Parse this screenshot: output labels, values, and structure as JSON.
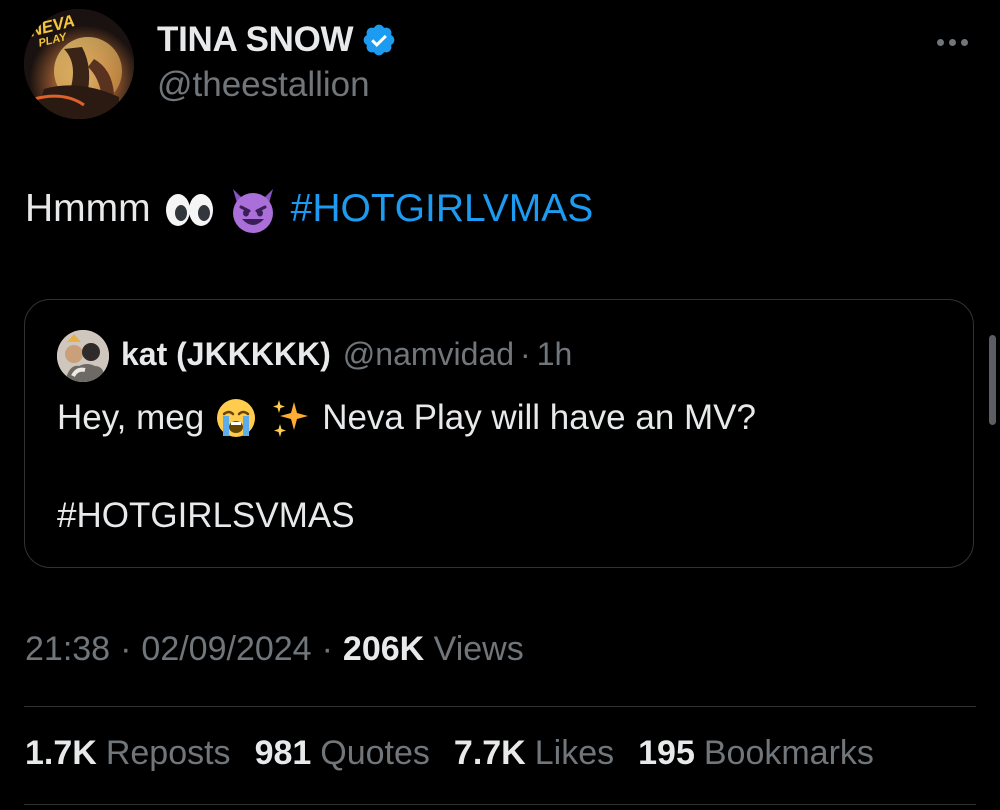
{
  "author": {
    "display_name": "TINA SNOW",
    "handle": "@theestallion",
    "verified": true,
    "avatar_logo_text_1": "NEVA",
    "avatar_logo_text_2": "PLAY"
  },
  "tweet": {
    "text": "Hmmm",
    "emojis": [
      "eyes-emoji",
      "smiling-devil-emoji"
    ],
    "hashtag": "#HOTGIRLVMAS"
  },
  "quoted_tweet": {
    "display_name": "kat (JKKKKK)",
    "handle": "@namvidad",
    "separator": "·",
    "time": "1h",
    "text_before_emoji": "Hey, meg",
    "emojis": [
      "loudly-crying-emoji",
      "sparkles-emoji"
    ],
    "text_after_emoji": "Neva Play will have an MV?",
    "hashtag": "#HOTGIRLSVMAS"
  },
  "meta": {
    "time": "21:38",
    "sep1": "·",
    "date": "02/09/2024",
    "sep2": "·",
    "views_count": "206K",
    "views_label": "Views"
  },
  "stats": {
    "reposts_count": "1.7K",
    "reposts_label": "Reposts",
    "quotes_count": "981",
    "quotes_label": "Quotes",
    "likes_count": "7.7K",
    "likes_label": "Likes",
    "bookmarks_count": "195",
    "bookmarks_label": "Bookmarks"
  },
  "colors": {
    "background": "#000000",
    "text_primary": "#e7e9ea",
    "text_secondary": "#71767b",
    "accent": "#1d9bf0",
    "border": "#2f3336"
  }
}
